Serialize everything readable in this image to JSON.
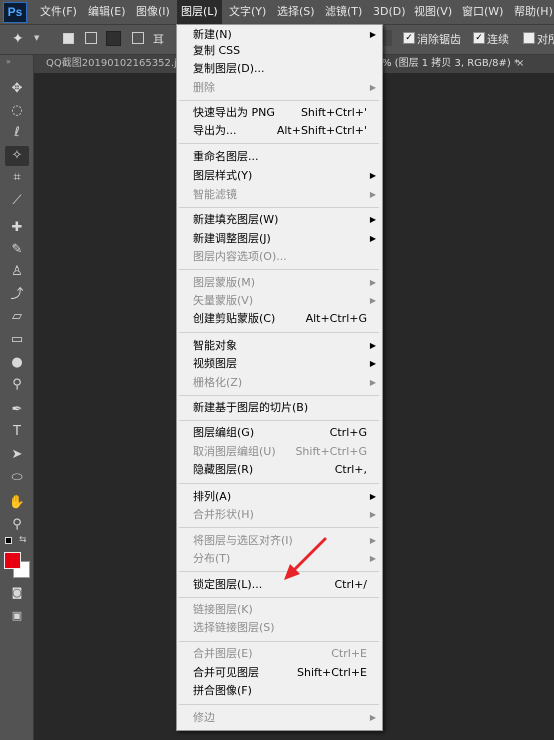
{
  "app": {
    "logo": "Ps"
  },
  "menubar": {
    "items": [
      "文件(F)",
      "编辑(E)",
      "图像(I)",
      "图层(L)",
      "文字(Y)",
      "选择(S)",
      "滤镜(T)",
      "3D(D)",
      "视图(V)",
      "窗口(W)",
      "帮助(H)"
    ],
    "active": "图层(L)"
  },
  "options": {
    "antialias_label": "消除锯齿",
    "contiguous_label": "连续",
    "sample_all_label": "对所"
  },
  "document": {
    "tab_left": "QQ截图20190102165352.jp",
    "tab_right": "% (图层 1 拷贝 3, RGB/8#) *",
    "close": "×"
  },
  "icons": {
    "submenu_arrow": "triangle-right-icon",
    "annotation_arrow": "red-arrow-icon"
  },
  "colors": {
    "foreground": "#e60012",
    "background": "#ffffff",
    "annotation": "#e8232a"
  },
  "dropdown": {
    "items": [
      {
        "label": "新建(N)",
        "shortcut": "",
        "submenu": true,
        "disabled": false
      },
      {
        "label": "复制 CSS",
        "shortcut": "",
        "submenu": false,
        "disabled": false
      },
      {
        "label": "复制图层(D)...",
        "shortcut": "",
        "submenu": false,
        "disabled": false
      },
      {
        "label": "删除",
        "shortcut": "",
        "submenu": true,
        "disabled": true
      },
      {
        "label": "快速导出为 PNG",
        "shortcut": "Shift+Ctrl+'",
        "submenu": false,
        "disabled": false
      },
      {
        "label": "导出为...",
        "shortcut": "Alt+Shift+Ctrl+'",
        "submenu": false,
        "disabled": false
      },
      {
        "label": "重命名图层...",
        "shortcut": "",
        "submenu": false,
        "disabled": false
      },
      {
        "label": "图层样式(Y)",
        "shortcut": "",
        "submenu": true,
        "disabled": false
      },
      {
        "label": "智能滤镜",
        "shortcut": "",
        "submenu": true,
        "disabled": true
      },
      {
        "label": "新建填充图层(W)",
        "shortcut": "",
        "submenu": true,
        "disabled": false
      },
      {
        "label": "新建调整图层(J)",
        "shortcut": "",
        "submenu": true,
        "disabled": false
      },
      {
        "label": "图层内容选项(O)...",
        "shortcut": "",
        "submenu": false,
        "disabled": true
      },
      {
        "label": "图层蒙版(M)",
        "shortcut": "",
        "submenu": true,
        "disabled": true
      },
      {
        "label": "矢量蒙版(V)",
        "shortcut": "",
        "submenu": true,
        "disabled": true
      },
      {
        "label": "创建剪贴蒙版(C)",
        "shortcut": "Alt+Ctrl+G",
        "submenu": false,
        "disabled": false
      },
      {
        "label": "智能对象",
        "shortcut": "",
        "submenu": true,
        "disabled": false
      },
      {
        "label": "视频图层",
        "shortcut": "",
        "submenu": true,
        "disabled": false
      },
      {
        "label": "栅格化(Z)",
        "shortcut": "",
        "submenu": true,
        "disabled": true
      },
      {
        "label": "新建基于图层的切片(B)",
        "shortcut": "",
        "submenu": false,
        "disabled": false
      },
      {
        "label": "图层编组(G)",
        "shortcut": "Ctrl+G",
        "submenu": false,
        "disabled": false
      },
      {
        "label": "取消图层编组(U)",
        "shortcut": "Shift+Ctrl+G",
        "submenu": false,
        "disabled": true
      },
      {
        "label": "隐藏图层(R)",
        "shortcut": "Ctrl+,",
        "submenu": false,
        "disabled": false
      },
      {
        "label": "排列(A)",
        "shortcut": "",
        "submenu": true,
        "disabled": false
      },
      {
        "label": "合并形状(H)",
        "shortcut": "",
        "submenu": true,
        "disabled": true
      },
      {
        "label": "将图层与选区对齐(I)",
        "shortcut": "",
        "submenu": true,
        "disabled": true
      },
      {
        "label": "分布(T)",
        "shortcut": "",
        "submenu": true,
        "disabled": true
      },
      {
        "label": "锁定图层(L)...",
        "shortcut": "Ctrl+/",
        "submenu": false,
        "disabled": false
      },
      {
        "label": "链接图层(K)",
        "shortcut": "",
        "submenu": false,
        "disabled": true
      },
      {
        "label": "选择链接图层(S)",
        "shortcut": "",
        "submenu": false,
        "disabled": true
      },
      {
        "label": "合并图层(E)",
        "shortcut": "Ctrl+E",
        "submenu": false,
        "disabled": true
      },
      {
        "label": "合并可见图层",
        "shortcut": "Shift+Ctrl+E",
        "submenu": false,
        "disabled": false
      },
      {
        "label": "拼合图像(F)",
        "shortcut": "",
        "submenu": false,
        "disabled": false
      },
      {
        "label": "修边",
        "shortcut": "",
        "submenu": true,
        "disabled": true
      }
    ]
  }
}
